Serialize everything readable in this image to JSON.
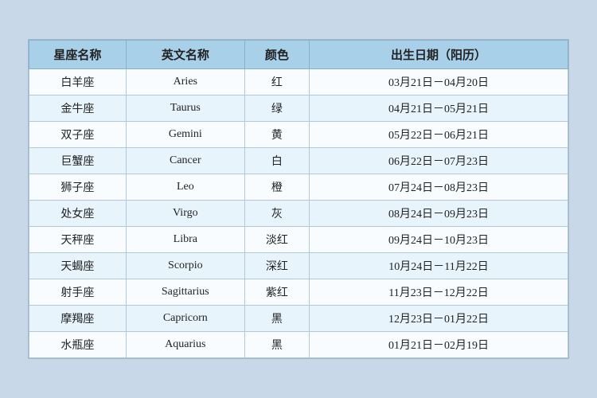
{
  "headers": {
    "chinese_name": "星座名称",
    "english_name": "英文名称",
    "color": "颜色",
    "birthday": "出生日期（阳历）"
  },
  "rows": [
    {
      "chinese": "白羊座",
      "english": "Aries",
      "color": "红",
      "date": "03月21日－04月20日"
    },
    {
      "chinese": "金牛座",
      "english": "Taurus",
      "color": "绿",
      "date": "04月21日－05月21日"
    },
    {
      "chinese": "双子座",
      "english": "Gemini",
      "color": "黄",
      "date": "05月22日－06月21日"
    },
    {
      "chinese": "巨蟹座",
      "english": "Cancer",
      "color": "白",
      "date": "06月22日－07月23日"
    },
    {
      "chinese": "狮子座",
      "english": "Leo",
      "color": "橙",
      "date": "07月24日－08月23日"
    },
    {
      "chinese": "处女座",
      "english": "Virgo",
      "color": "灰",
      "date": "08月24日－09月23日"
    },
    {
      "chinese": "天秤座",
      "english": "Libra",
      "color": "淡红",
      "date": "09月24日－10月23日"
    },
    {
      "chinese": "天蝎座",
      "english": "Scorpio",
      "color": "深红",
      "date": "10月24日－11月22日"
    },
    {
      "chinese": "射手座",
      "english": "Sagittarius",
      "color": "紫红",
      "date": "11月23日－12月22日"
    },
    {
      "chinese": "摩羯座",
      "english": "Capricorn",
      "color": "黑",
      "date": "12月23日－01月22日"
    },
    {
      "chinese": "水瓶座",
      "english": "Aquarius",
      "color": "黑",
      "date": "01月21日－02月19日"
    }
  ]
}
